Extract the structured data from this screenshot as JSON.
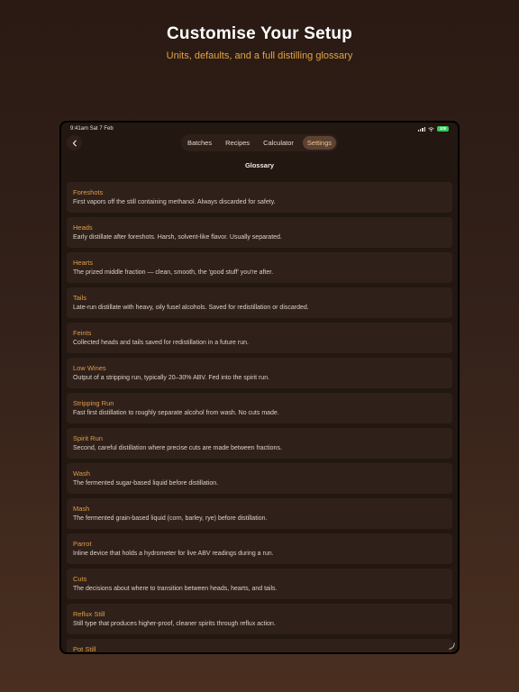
{
  "promo": {
    "title": "Customise Your Setup",
    "subtitle": "Units, defaults, and a full distilling glossary"
  },
  "status_bar": {
    "time": "9:41am  Sat 7 Feb",
    "battery": "100"
  },
  "tabs": [
    {
      "label": "Batches",
      "active": false
    },
    {
      "label": "Recipes",
      "active": false
    },
    {
      "label": "Calculator",
      "active": false
    },
    {
      "label": "Settings",
      "active": true
    }
  ],
  "screen_title": "Glossary",
  "glossary": [
    {
      "term": "Foreshots",
      "definition": "First vapors off the still containing methanol. Always discarded for safety."
    },
    {
      "term": "Heads",
      "definition": "Early distillate after foreshots. Harsh, solvent-like flavor. Usually separated."
    },
    {
      "term": "Hearts",
      "definition": "The prized middle fraction — clean, smooth, the 'good stuff' you're after."
    },
    {
      "term": "Tails",
      "definition": "Late-run distillate with heavy, oily fusel alcohols. Saved for redistillation or discarded."
    },
    {
      "term": "Feints",
      "definition": "Collected heads and tails saved for redistillation in a future run."
    },
    {
      "term": "Low Wines",
      "definition": "Output of a stripping run, typically 20–30% ABV. Fed into the spirit run."
    },
    {
      "term": "Stripping Run",
      "definition": "Fast first distillation to roughly separate alcohol from wash. No cuts made."
    },
    {
      "term": "Spirit Run",
      "definition": "Second, careful distillation where precise cuts are made between fractions."
    },
    {
      "term": "Wash",
      "definition": "The fermented sugar-based liquid before distillation."
    },
    {
      "term": "Mash",
      "definition": "The fermented grain-based liquid (corn, barley, rye) before distillation."
    },
    {
      "term": "Parrot",
      "definition": "Inline device that holds a hydrometer for live ABV readings during a run."
    },
    {
      "term": "Cuts",
      "definition": "The decisions about where to transition between heads, hearts, and tails."
    },
    {
      "term": "Reflux Still",
      "definition": "Still type that produces higher-proof, cleaner spirits through reflux action."
    },
    {
      "term": "Pot Still",
      "definition": ""
    }
  ],
  "colors": {
    "accent": "#df9b4a",
    "subtitle": "#e0a446",
    "card": "#2f211a",
    "background": "#231711"
  },
  "icons": [
    "back-chevron-icon",
    "signal-icon",
    "wifi-icon",
    "battery-icon"
  ]
}
